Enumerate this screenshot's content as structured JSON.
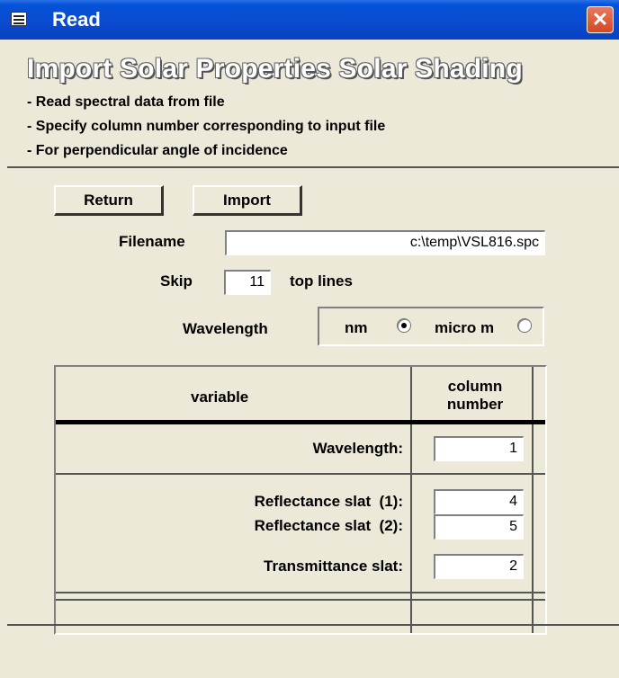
{
  "window": {
    "title": "Read"
  },
  "header": {
    "title": "Import Solar Properties Solar Shading",
    "bullets": [
      "- Read spectral data from file",
      "- Specify column number corresponding to input file",
      "- For perpendicular angle of incidence"
    ]
  },
  "buttons": {
    "return_label": "Return",
    "import_label": "Import"
  },
  "form": {
    "filename_label": "Filename",
    "filename_value": "c:\\temp\\VSL816.spc",
    "skip_label": "Skip",
    "skip_value": "11",
    "skip_suffix": "top lines",
    "wavelength_label": "Wavelength",
    "unit_options": [
      {
        "label": "nm",
        "selected": true
      },
      {
        "label": "micro m",
        "selected": false
      }
    ]
  },
  "table": {
    "headers": {
      "variable": "variable",
      "column_number": "column number"
    },
    "rows": [
      {
        "label": "Wavelength:",
        "value": "1"
      },
      {
        "label": "Reflectance slat  (1):",
        "value": "4"
      },
      {
        "label": "Reflectance slat  (2):",
        "value": "5"
      },
      {
        "label": "Transmittance slat:",
        "value": "2"
      }
    ]
  }
}
